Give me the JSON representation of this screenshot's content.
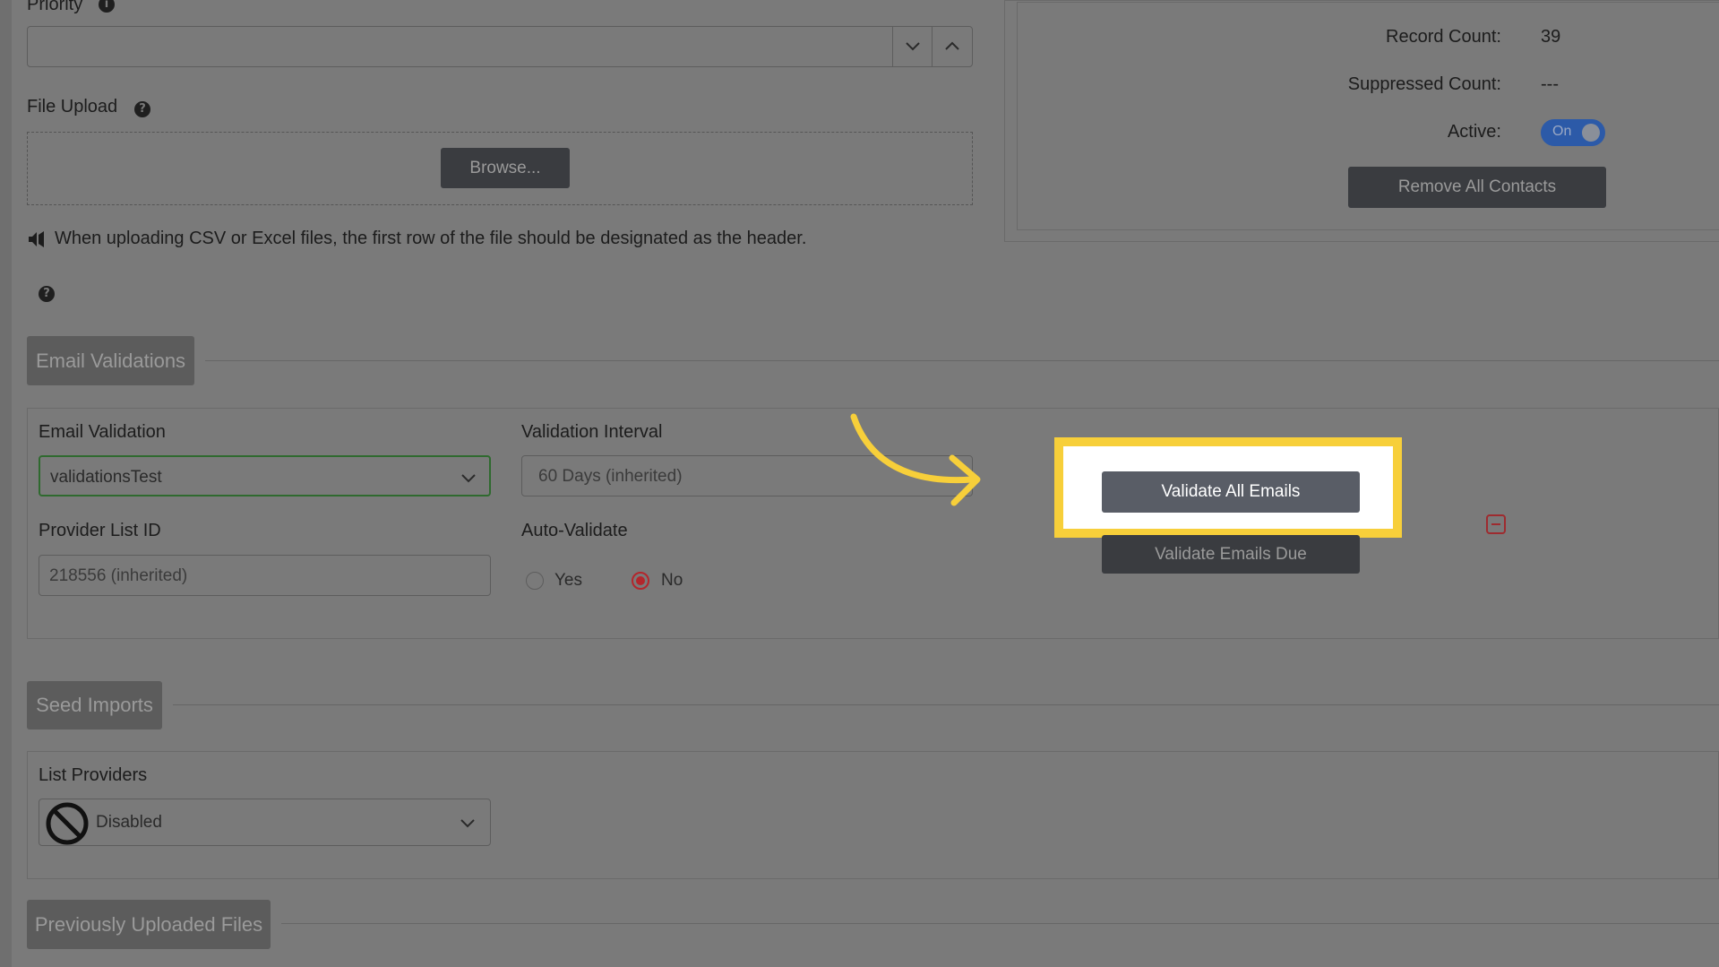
{
  "priority": {
    "label": "Priority"
  },
  "file_upload": {
    "label": "File Upload",
    "browse_label": "Browse..."
  },
  "notice_text": "When uploading CSV or Excel files, the first row of the file should be designated as the header.",
  "stats": {
    "record_count_label": "Record Count:",
    "record_count_value": "39",
    "suppressed_count_label": "Suppressed Count:",
    "suppressed_count_value": "---",
    "active_label": "Active:",
    "active_toggle": "On",
    "remove_all_label": "Remove All Contacts"
  },
  "email_validations": {
    "section_label": "Email Validations",
    "email_validation_label": "Email Validation",
    "email_validation_value": "validationsTest",
    "validation_interval_label": "Validation Interval",
    "validation_interval_value": "60 Days (inherited)",
    "provider_list_id_label": "Provider List ID",
    "provider_list_id_value": "218556 (inherited)",
    "auto_validate_label": "Auto-Validate",
    "yes_label": "Yes",
    "no_label": "No",
    "auto_validate_selected": "No",
    "validate_all_label": "Validate All Emails",
    "validate_due_label": "Validate Emails Due"
  },
  "seed_imports": {
    "section_label": "Seed Imports",
    "list_providers_label": "List Providers",
    "list_providers_value": "Disabled"
  },
  "previous_files": {
    "section_label": "Previously Uploaded Files"
  },
  "colors": {
    "highlight": "#f7cf3a",
    "background_dim": "#7a7a7a",
    "radio_selected": "#b3262c",
    "toggle_on": "#2c5aa8"
  },
  "icons": [
    "info-icon",
    "help-icon",
    "megaphone-icon",
    "chevron-down-icon",
    "chevron-up-icon",
    "minus-square-icon",
    "disabled-icon",
    "arrow-icon"
  ]
}
